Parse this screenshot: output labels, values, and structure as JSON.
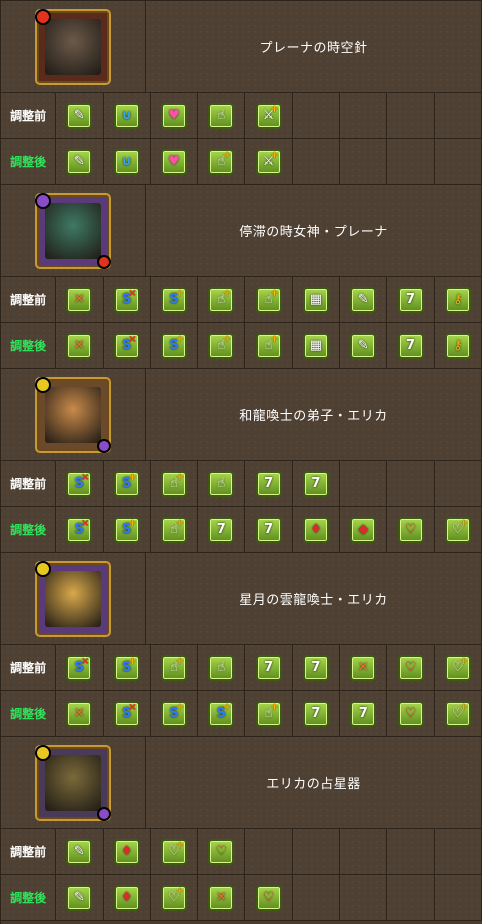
{
  "labels": {
    "before": "調整前",
    "after": "調整後"
  },
  "entries": [
    {
      "name": "プレーナの時空針",
      "portrait": {
        "frame": "#5a2a1c",
        "orb": "#e0321d",
        "orb2": null,
        "art": "#6b5a4a"
      },
      "before": [
        "board-change-icon",
        "combo-icon",
        "drop-heal-icon",
        "finger-icon",
        "sword-plus-icon"
      ],
      "after": [
        "board-change-icon",
        "combo-icon",
        "drop-heal-icon",
        "finger-plus-icon",
        "sword-plus-icon"
      ]
    },
    {
      "name": "停滞の時女神・プレーナ",
      "portrait": {
        "frame": "#5a3a7a",
        "orb": "#8a4bc9",
        "orb2": "#e0321d",
        "art": "#3f7a66"
      },
      "before": [
        "cross-icon",
        "skill-boost-cross-icon",
        "skill-boost-plus-icon",
        "finger-plus-icon",
        "finger-plus-icon",
        "bind-icon",
        "pen-icon",
        "seven-combo-icon",
        "key-icon"
      ],
      "after": [
        "cross-icon",
        "skill-boost-cross-icon",
        "skill-boost-plus-icon",
        "finger-plus-icon",
        "finger-plus-icon",
        "bind-icon",
        "pen-icon",
        "seven-combo-icon",
        "key-icon"
      ]
    },
    {
      "name": "和龍喚士の弟子・エリカ",
      "portrait": {
        "frame": "#6a4a2a",
        "orb": "#e6c81e",
        "orb2": "#8a4bc9",
        "art": "#c98a4a"
      },
      "before": [
        "skill-boost-cross-icon",
        "skill-boost-plus-icon",
        "finger-plus-icon",
        "finger-icon",
        "seven-combo-icon",
        "seven-combo-icon"
      ],
      "after": [
        "skill-boost-cross-icon",
        "skill-boost-plus-icon",
        "finger-plus-icon",
        "seven-combo-icon",
        "seven-combo-icon",
        "enhanced-icon",
        "diamond-icon",
        "heart-diamond-icon",
        "heart-plus-icon"
      ]
    },
    {
      "name": "星月の雲龍喚士・エリカ",
      "portrait": {
        "frame": "#5a3a7a",
        "orb": "#e6c81e",
        "orb2": null,
        "art": "#d9a94a"
      },
      "before": [
        "skill-boost-cross-icon",
        "skill-boost-plus-icon",
        "finger-plus-icon",
        "finger-icon",
        "seven-combo-icon",
        "seven-combo-icon",
        "cross-icon",
        "heart-diamond-icon",
        "heart-plus-icon"
      ],
      "after": [
        "cross-icon",
        "skill-boost-cross-icon",
        "skill-boost-plus-icon",
        "skill-boost-plus-icon",
        "finger-plus-icon",
        "seven-combo-icon",
        "seven-combo-icon",
        "heart-diamond-icon",
        "heart-plus-icon"
      ]
    },
    {
      "name": "エリカの占星器",
      "portrait": {
        "frame": "#4a3a5a",
        "orb": "#e6c81e",
        "orb2": "#8a4bc9",
        "art": "#7a6a3a"
      },
      "before": [
        "board-change-icon",
        "enhanced-icon",
        "heart-plus-icon",
        "heart-diamond-icon"
      ],
      "after": [
        "board-change-icon",
        "enhanced-icon",
        "heart-plus-icon",
        "cross-icon",
        "heart-diamond-icon"
      ]
    }
  ],
  "icon_glyphs": {
    "board-change-icon": "✎",
    "combo-icon": "∪",
    "drop-heal-icon": "♥",
    "finger-icon": "☝",
    "finger-plus-icon": "☝",
    "sword-plus-icon": "⚔",
    "cross-icon": "✕",
    "skill-boost-cross-icon": "S",
    "skill-boost-plus-icon": "S",
    "bind-icon": "▦",
    "pen-icon": "✎",
    "seven-combo-icon": "7",
    "key-icon": "⚷",
    "enhanced-icon": "♦",
    "diamond-icon": "◆",
    "heart-diamond-icon": "♡",
    "heart-plus-icon": "♡"
  }
}
